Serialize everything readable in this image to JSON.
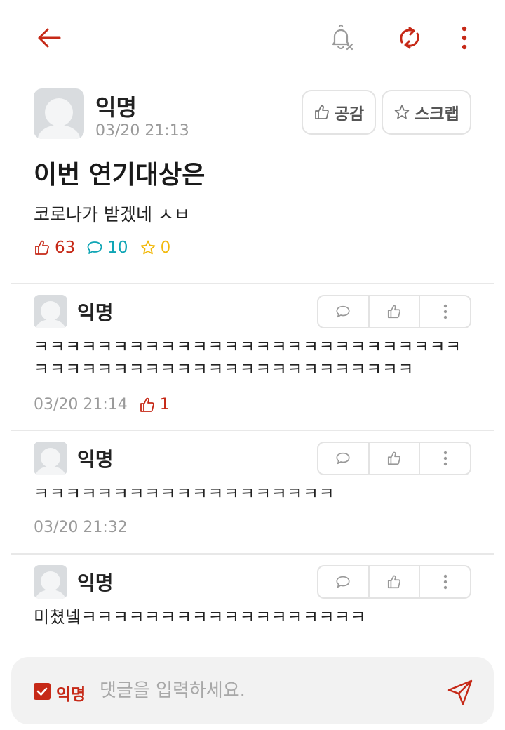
{
  "colors": {
    "accent": "#c62917",
    "comment": "#0fa5b5",
    "scrap": "#f2b90c",
    "muted": "#9a9a9a"
  },
  "topbar": {
    "icons": [
      "back-arrow-icon",
      "notification-off-icon",
      "refresh-icon",
      "more-vertical-icon"
    ]
  },
  "post": {
    "author": "익명",
    "time": "03/20 21:13",
    "like_button": "공감",
    "scrap_button": "스크랩",
    "title": "이번 연기대상은",
    "body": "코로나가 받겠네 ㅅㅂ",
    "stats": {
      "likes": "63",
      "comments": "10",
      "scraps": "0"
    }
  },
  "comments": [
    {
      "author": "익명",
      "text": "ㅋㅋㅋㅋㅋㅋㅋㅋㅋㅋㅋㅋㅋㅋㅋㅋㅋㅋㅋㅋㅋㅋㅋㅋㅋㅋㅋㅋㅋㅋㅋㅋㅋㅋㅋㅋㅋㅋㅋㅋㅋㅋㅋㅋㅋㅋㅋㅋㅋㅋㅋ",
      "time": "03/20 21:14",
      "likes": "1"
    },
    {
      "author": "익명",
      "text": "ㅋㅋㅋㅋㅋㅋㅋㅋㅋㅋㅋㅋㅋㅋㅋㅋㅋㅋㅋ",
      "time": "03/20 21:32",
      "likes": ""
    },
    {
      "author": "익명",
      "text": "미쳤넼ㅋㅋㅋㅋㅋㅋㅋㅋㅋㅋㅋㅋㅋㅋㅋㅋㅋㅋ",
      "time": "",
      "likes": ""
    }
  ],
  "composer": {
    "anonymous_label": "익명",
    "anonymous_checked": true,
    "placeholder": "댓글을 입력하세요."
  }
}
